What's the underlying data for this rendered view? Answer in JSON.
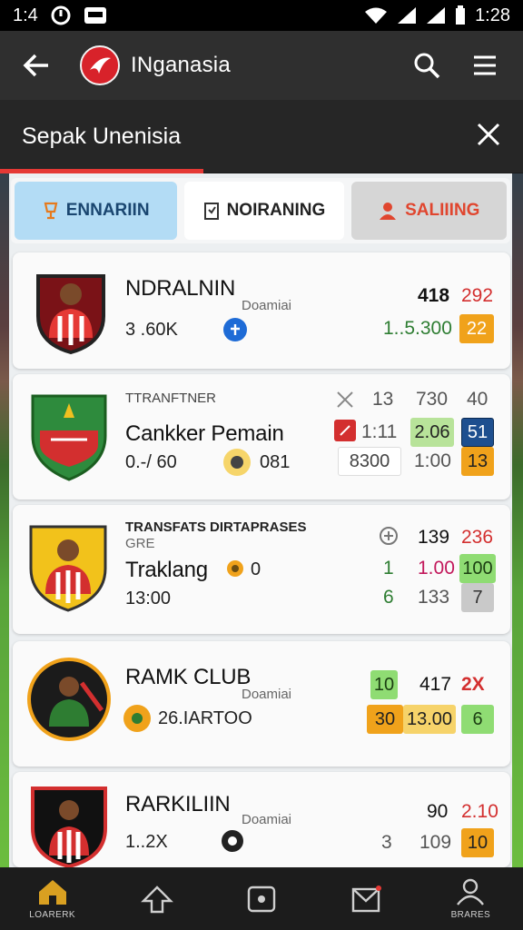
{
  "status": {
    "left_text": "1:4",
    "time": "1:28"
  },
  "header": {
    "app_title": "INganasia"
  },
  "section": {
    "title": "Sepak Unenisia"
  },
  "tabs": [
    {
      "label": "ENNARIIN"
    },
    {
      "label": "NOIRANING"
    },
    {
      "label": "SALIIING"
    }
  ],
  "cards": [
    {
      "name": "NDRALNIN",
      "small": "Doamiai",
      "sub": "3 .60K",
      "stats": [
        "418",
        "292",
        "1..5.300",
        "22"
      ]
    },
    {
      "top": "TTRANFTNER",
      "name": "Cankker Pemain",
      "sub": "0.-/ 60",
      "sub2": "081",
      "stats": [
        "13",
        "730",
        "40",
        "1:11",
        "2.06",
        "51",
        "8300",
        "1:00",
        "13"
      ]
    },
    {
      "top": "TRANSFATS DIRTAPRASES",
      "top2": "GRE",
      "name": "Traklang",
      "sub_val": "0",
      "sub": "13:00",
      "stats": [
        "139",
        "236",
        "1",
        "1.00",
        "100",
        "6",
        "133",
        "7"
      ]
    },
    {
      "name": "RAMK CLUB",
      "small": "Doamiai",
      "sub": "26.IARTOO",
      "stats": [
        "10",
        "417",
        "2X",
        "30",
        "13.00",
        "6"
      ]
    },
    {
      "name": "RARKILIIN",
      "small": "Doamiai",
      "sub": "1..2X",
      "stats": [
        "90",
        "2.10",
        "3",
        "109",
        "10"
      ]
    }
  ],
  "nav": [
    {
      "label": "LOARERK",
      "icon": "home-icon"
    },
    {
      "label": "",
      "icon": "up-arrow-icon"
    },
    {
      "label": "",
      "icon": "device-icon"
    },
    {
      "label": "",
      "icon": "message-icon"
    },
    {
      "label": "BRARES",
      "icon": "user-icon"
    }
  ],
  "colors": {
    "accent_red": "#e53935",
    "orange": "#f0a21b",
    "green": "#8fdc73"
  }
}
